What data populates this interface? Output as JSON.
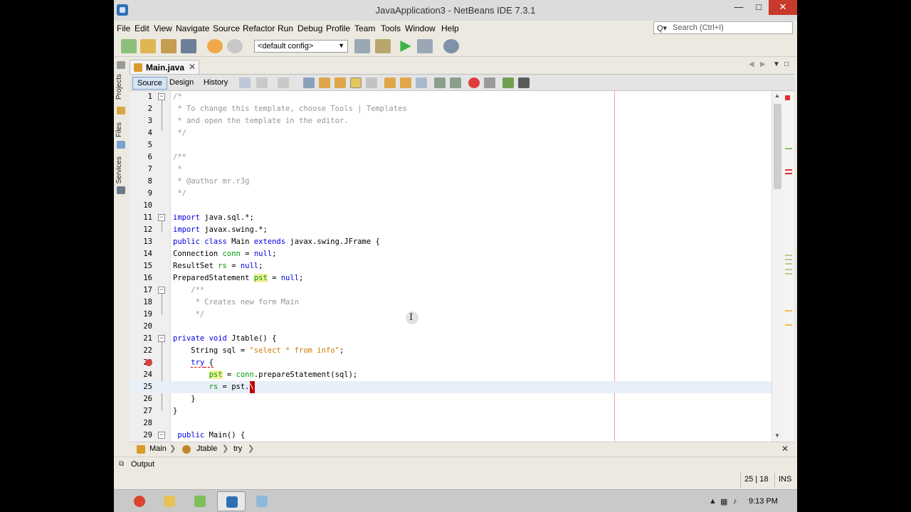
{
  "window": {
    "title": "JavaApplication3 - NetBeans IDE 7.3.1",
    "min_glyph": "—",
    "max_glyph": "□",
    "close_glyph": "✕"
  },
  "menu": [
    "File",
    "Edit",
    "View",
    "Navigate",
    "Source",
    "Refactor",
    "Run",
    "Debug",
    "Profile",
    "Team",
    "Tools",
    "Window",
    "Help"
  ],
  "search": {
    "placeholder": "Search (Ctrl+I)",
    "icon_glyph": "Q▾"
  },
  "toolbar": {
    "config": "<default config>"
  },
  "sidebar": [
    "Projects",
    "Files",
    "Services"
  ],
  "tab": {
    "label": "Main.java",
    "close_glyph": "✕"
  },
  "views": [
    "Source",
    "Design",
    "History"
  ],
  "code_lines": [
    {
      "n": "1"
    },
    {
      "n": "2"
    },
    {
      "n": "3"
    },
    {
      "n": "4"
    },
    {
      "n": "5"
    },
    {
      "n": "6"
    },
    {
      "n": "7"
    },
    {
      "n": "8"
    },
    {
      "n": "9"
    },
    {
      "n": "10"
    },
    {
      "n": "11"
    },
    {
      "n": "12"
    },
    {
      "n": "13"
    },
    {
      "n": "14"
    },
    {
      "n": "15"
    },
    {
      "n": "16"
    },
    {
      "n": "17"
    },
    {
      "n": "18"
    },
    {
      "n": "19"
    },
    {
      "n": "20"
    },
    {
      "n": "21"
    },
    {
      "n": "22"
    },
    {
      "n": "23"
    },
    {
      "n": "24"
    },
    {
      "n": "25"
    },
    {
      "n": "26"
    },
    {
      "n": "27"
    },
    {
      "n": "28"
    },
    {
      "n": "29"
    }
  ],
  "code_text": {
    "l1": "/*",
    "l2": " * To change this template, choose Tools | Templates",
    "l3": " * and open the template in the editor.",
    "l4": " */",
    "l6": "/**",
    "l7": " *",
    "l8": " * @author mr.r3g",
    "l9": " */",
    "l11a": "import",
    "l11b": " java.sql.*;",
    "l12a": "import",
    "l12b": " javax.swing.*;",
    "l13a": "public class",
    "l13b": " Main ",
    "l13c": "extends",
    "l13d": " javax.swing.JFrame {",
    "l14a": "Connection ",
    "l14b": "conn",
    "l14c": " = ",
    "l14d": "null",
    "l14e": ";",
    "l15a": "ResultSet ",
    "l15b": "rs",
    "l15c": " = ",
    "l15d": "null",
    "l15e": ";",
    "l16a": "PreparedStatement ",
    "l16b": "pst",
    "l16c": " = ",
    "l16d": "null",
    "l16e": ";",
    "l17": "    /**",
    "l18": "     * Creates new form Main",
    "l19": "     */",
    "l21a": "private void",
    "l21b": " Jtable() {",
    "l22a": "    String sql = ",
    "l22b": "\"select * from info\"",
    "l22c": ";",
    "l23a": "    ",
    "l23b": "try",
    "l23c": " {",
    "l24a": "        ",
    "l24b": "pst",
    "l24c": " = ",
    "l24d": "conn",
    "l24e": ".prepareStatement(sql);",
    "l25a": "        ",
    "l25b": "rs",
    "l25c": " = pst.",
    "l25d": "\\",
    "l26": "    }",
    "l27": "}",
    "l29a": " public",
    "l29b": " Main() {"
  },
  "breadcrumb": {
    "items": [
      "Main",
      "Jtable",
      "try"
    ],
    "sep": "❯",
    "close_glyph": "✕"
  },
  "output": {
    "label": "Output"
  },
  "status": {
    "position": "25 | 18",
    "mode": "INS"
  },
  "taskbar": {
    "clock": "9:13 PM"
  }
}
